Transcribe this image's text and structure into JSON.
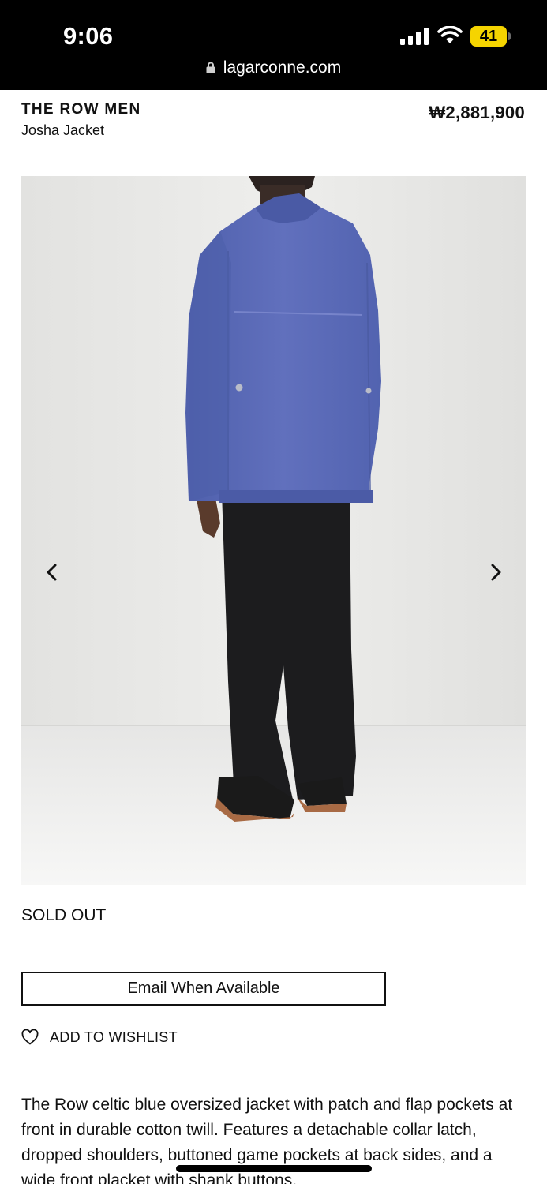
{
  "status_bar": {
    "time": "9:06",
    "battery": "41",
    "battery_color": "#f5d400",
    "icons": [
      "cellular-signal-icon",
      "wifi-icon",
      "battery-icon"
    ]
  },
  "browser": {
    "url": "lagarconne.com",
    "lock_icon": "lock-icon"
  },
  "product": {
    "brand": "THE ROW MEN",
    "name": "Josha Jacket",
    "price": "₩2,881,900",
    "availability": "SOLD OUT",
    "email_button": "Email When Available",
    "wishlist_label": "ADD TO WISHLIST",
    "description": "The Row celtic blue oversized jacket with patch and flap pockets at front in durable cotton twill. Features a detachable collar latch, dropped shoulders, buttoned game pockets at back sides, and a wide front placket with shank buttons."
  },
  "gallery": {
    "prev_icon": "chevron-left-icon",
    "next_icon": "chevron-right-icon",
    "jacket_color": "#5b6cb8"
  }
}
